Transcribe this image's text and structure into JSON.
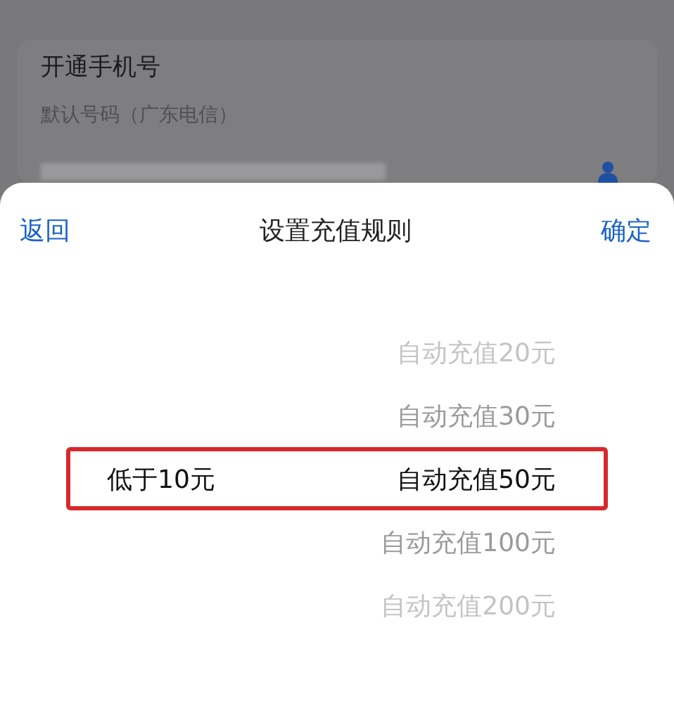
{
  "background_card": {
    "title": "开通手机号",
    "subtitle": "默认号码（广东电信）"
  },
  "sheet": {
    "back": "返回",
    "title": "设置充值规则",
    "confirm": "确定"
  },
  "picker": {
    "rows": [
      {
        "threshold": "",
        "amount": "自动充值20元",
        "selected": false
      },
      {
        "threshold": "",
        "amount": "自动充值30元",
        "selected": false
      },
      {
        "threshold": "低于10元",
        "amount": "自动充值50元",
        "selected": true
      },
      {
        "threshold": "",
        "amount": "自动充值100元",
        "selected": false
      },
      {
        "threshold": "",
        "amount": "自动充值200元",
        "selected": false
      }
    ]
  }
}
